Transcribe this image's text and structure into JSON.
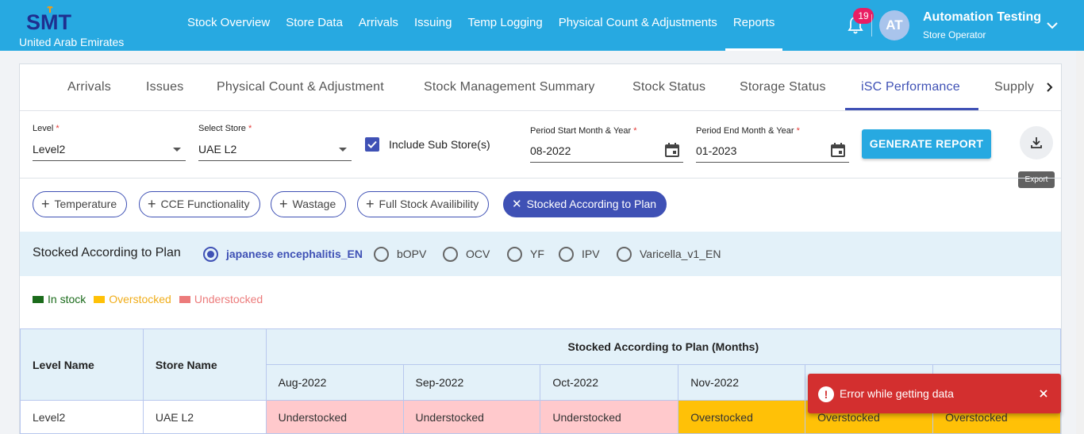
{
  "header": {
    "logo_text": "SMT",
    "country": "United Arab Emirates",
    "nav": [
      "Stock Overview",
      "Store Data",
      "Arrivals",
      "Issuing",
      "Temp Logging",
      "Physical Count & Adjustments",
      "Reports"
    ],
    "active_nav": "Reports",
    "notification_count": "19",
    "user_initials": "AT",
    "user_name": "Automation Testing",
    "user_role": "Store Operator"
  },
  "tabs": [
    "Arrivals",
    "Issues",
    "Physical Count & Adjustment",
    "Stock Management Summary",
    "Stock Status",
    "Storage Status",
    "iSC Performance",
    "Supply"
  ],
  "active_tab": "iSC Performance",
  "filters": {
    "level_label": "Level",
    "level_value": "Level2",
    "store_label": "Select Store",
    "store_value": "UAE L2",
    "include_sub_label": "Include Sub Store(s)",
    "include_sub_checked": true,
    "start_label": "Period Start Month & Year",
    "start_value": "08-2022",
    "end_label": "Period End Month & Year",
    "end_value": "01-2023",
    "required_mark": "*",
    "generate_label": "GENERATE REPORT",
    "export_tooltip": "Export"
  },
  "chips": [
    {
      "label": "Temperature",
      "selected": false
    },
    {
      "label": "CCE Functionality",
      "selected": false
    },
    {
      "label": "Wastage",
      "selected": false
    },
    {
      "label": "Full Stock Availibility",
      "selected": false
    },
    {
      "label": "Stocked According to Plan",
      "selected": true
    }
  ],
  "product_select": {
    "title": "Stocked According to Plan",
    "options": [
      "japanese encephalitis_EN",
      "bOPV",
      "OCV",
      "YF",
      "IPV",
      "Varicella_v1_EN"
    ],
    "selected": "japanese encephalitis_EN"
  },
  "legend": [
    {
      "label": "In stock",
      "color": "#1b6b1b",
      "text_color": "#1b6b1b"
    },
    {
      "label": "Overstocked",
      "color": "#ffc107",
      "text_color": "#f0ad1a"
    },
    {
      "label": "Understocked",
      "color": "#ec7b7b",
      "text_color": "#ec7b7b"
    }
  ],
  "table": {
    "col_level": "Level Name",
    "col_store": "Store Name",
    "group_header": "Stocked According to Plan (Months)",
    "months": [
      "Aug-2022",
      "Sep-2022",
      "Oct-2022",
      "Nov-2022",
      "",
      ""
    ],
    "rows": [
      {
        "level": "Level2",
        "store": "UAE L2",
        "cells": [
          "Understocked",
          "Understocked",
          "Understocked",
          "Overstocked",
          "Overstocked",
          "Overstocked"
        ]
      }
    ]
  },
  "snackbar": {
    "message": "Error while getting data",
    "icon": "!"
  }
}
